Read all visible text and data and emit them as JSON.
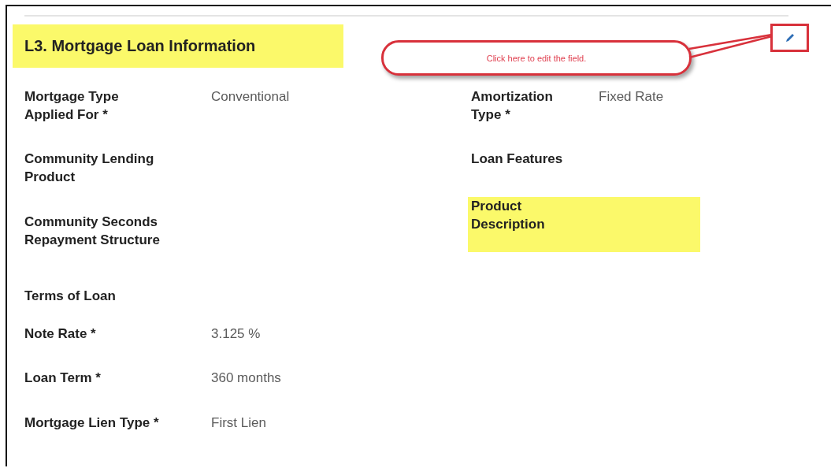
{
  "section": {
    "title": "L3. Mortgage Loan Information",
    "highlighted": true
  },
  "callout": {
    "text": "Click here to edit the field."
  },
  "left_fields": [
    {
      "kind": "field",
      "label": "Mortgage Type Applied For *",
      "value": "Conventional"
    },
    {
      "kind": "field",
      "label": "Community Lending Product"
    },
    {
      "kind": "field",
      "label": "Community Seconds Repayment Structure"
    },
    {
      "kind": "heading",
      "label": "Terms of Loan"
    },
    {
      "kind": "field",
      "label": "Note Rate *",
      "value": "3.125 %"
    },
    {
      "kind": "field",
      "label": "Loan Term *",
      "value": "360 months"
    },
    {
      "kind": "field",
      "label": "Mortgage Lien Type *",
      "value": "First Lien"
    }
  ],
  "right_fields": [
    {
      "label": "Amortization Type *",
      "value": "Fixed Rate",
      "highlighted": false
    },
    {
      "label": "Loan Features",
      "highlighted": false
    },
    {
      "label": "Product Description",
      "highlighted": true
    }
  ]
}
